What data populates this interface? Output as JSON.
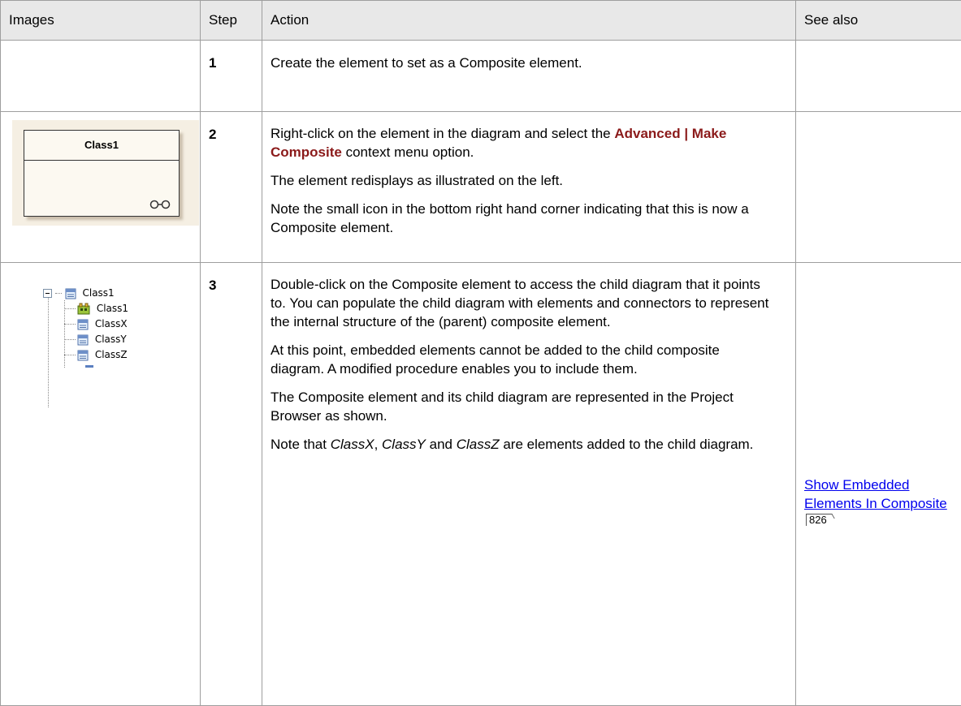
{
  "headers": {
    "images": "Images",
    "step": "Step",
    "action": "Action",
    "see_also": "See also"
  },
  "rows": [
    {
      "step": "1",
      "action": "Create the element to set as a Composite element."
    },
    {
      "step": "2",
      "image": {
        "class_name": "Class1",
        "icon": "composite-glasses-icon"
      },
      "action_p1_before": "Right-click on the element in the diagram and select the ",
      "action_p1_emph": "Advanced | Make Composite",
      "action_p1_after": " context menu option.",
      "action_p2": "The element redisplays as illustrated on the left.",
      "action_p3": "Note the small icon in the bottom right hand corner indicating that this is now a Composite element."
    },
    {
      "step": "3",
      "tree": {
        "root": "Class1",
        "children": [
          "Class1",
          "ClassX",
          "ClassY",
          "ClassZ"
        ]
      },
      "action_p1": "Double-click on the Composite element to access the child diagram that it points to. You can populate the child diagram with elements and connectors to represent the internal structure of the (parent) composite element.",
      "action_p2": "At this point, embedded elements cannot be added to the child composite diagram. A modified procedure enables you to include them.",
      "action_p3": "The Composite element and its child diagram are represented in the Project Browser as shown.",
      "action_p4_pre": "Note that ",
      "action_p4_x": "ClassX",
      "action_p4_sep1": ", ",
      "action_p4_y": "ClassY",
      "action_p4_and": " and ",
      "action_p4_z": "ClassZ",
      "action_p4_post": " are elements added to the child diagram.",
      "see_also_link": "Show Embedded Elements In Composite",
      "see_also_page": "826"
    }
  ],
  "colors": {
    "header_bg": "#e8e8e8",
    "border": "#9e9e9e",
    "emphasis": "#8b1a1a",
    "link": "#0000ee"
  }
}
